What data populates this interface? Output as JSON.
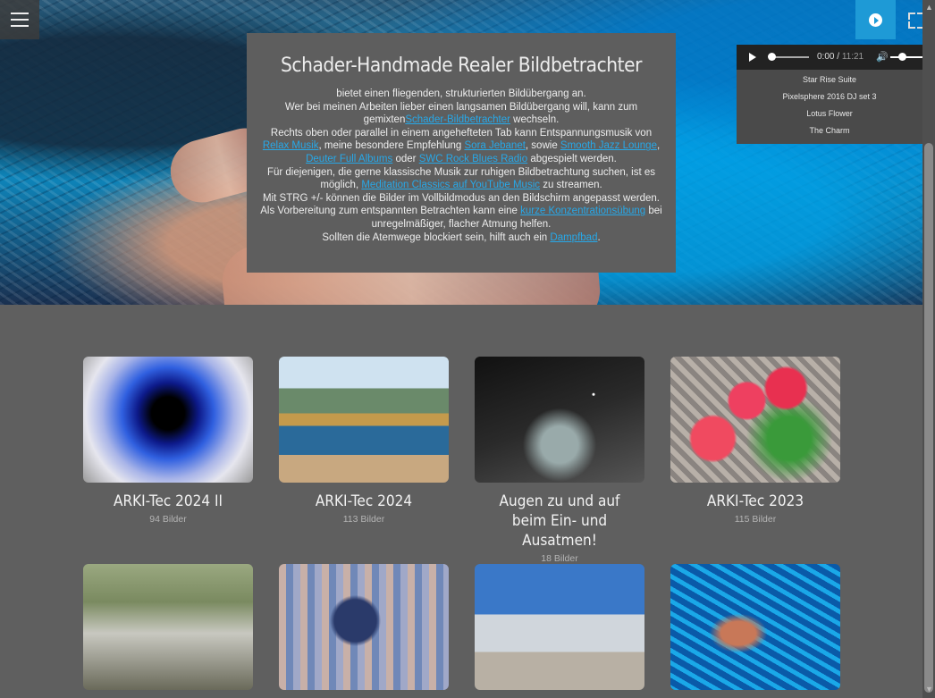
{
  "hero": {
    "title": "Schader-Handmade Realer Bildbetrachter",
    "p1": "bietet einen fliegenden, strukturierten Bildübergang an.",
    "p2a": "Wer bei meinen Arbeiten lieber einen langsamen Bildübergang will, kann zum gemixten",
    "link_slow": "Schader-Bildbetrachter",
    "p2b": "wechseln.",
    "p3a": "Rechts oben oder parallel in einem angehefteten Tab kann Entspannungsmusik von",
    "link_music1": "Relax Musik",
    "p3b": ", meine besondere Empfehlung",
    "link_music2": "Sora Jebanet",
    "p3c": ", sowie",
    "link_music3": "Smooth Jazz Lounge",
    "p3d": ",",
    "link_music4": "Deuter Full Albums",
    "p3e": "oder",
    "link_music5": "SWC Rock Blues Radio",
    "p3f": "abgespielt werden.",
    "p4a": "Für diejenigen, die gerne klassische Musik zur ruhigen Bildbetrachtung suchen, ist es möglich,",
    "link_classics": "Meditation Classics auf YouTube Music",
    "p4b": "zu streamen.",
    "p5": "Mit STRG +/- können die Bilder im Vollbildmodus an den Bildschirm angepasst werden.",
    "p6a": "Als Vorbereitung zum entspannten Betrachten kann eine",
    "link_breath": "kurze Konzentrationsübung",
    "p6b": "bei unregelmäßiger, flacher Atmung helfen.",
    "p7a": "Sollten die Atemwege blockiert sein, hilft auch ein",
    "link_steam": "Dampfbad",
    "p7b": "."
  },
  "player": {
    "time_current": "0:00",
    "time_total": "11:21",
    "progress": 0,
    "volume": 0.35,
    "playlist": [
      "Star Rise Suite",
      "Pixelsphere 2016 DJ set 3",
      "Lotus Flower",
      "The Charm"
    ]
  },
  "icons": {
    "menu": "hamburger-menu-icon",
    "play": "play-circle-icon",
    "fullscreen": "fullscreen-icon",
    "volume": "speaker-icon"
  },
  "accent_color": "#1e9ad6",
  "link_color": "#27a8e8",
  "albums": [
    {
      "title": "ARKI-Tec 2024 II",
      "count": "94 Bilder"
    },
    {
      "title": "ARKI-Tec 2024",
      "count": "113 Bilder"
    },
    {
      "title": "Augen zu und auf beim Ein- und Ausatmen!",
      "count": "18 Bilder"
    },
    {
      "title": "ARKI-Tec 2023",
      "count": "115 Bilder"
    },
    {
      "title": "",
      "count": ""
    },
    {
      "title": "",
      "count": ""
    },
    {
      "title": "",
      "count": ""
    },
    {
      "title": "",
      "count": ""
    }
  ]
}
